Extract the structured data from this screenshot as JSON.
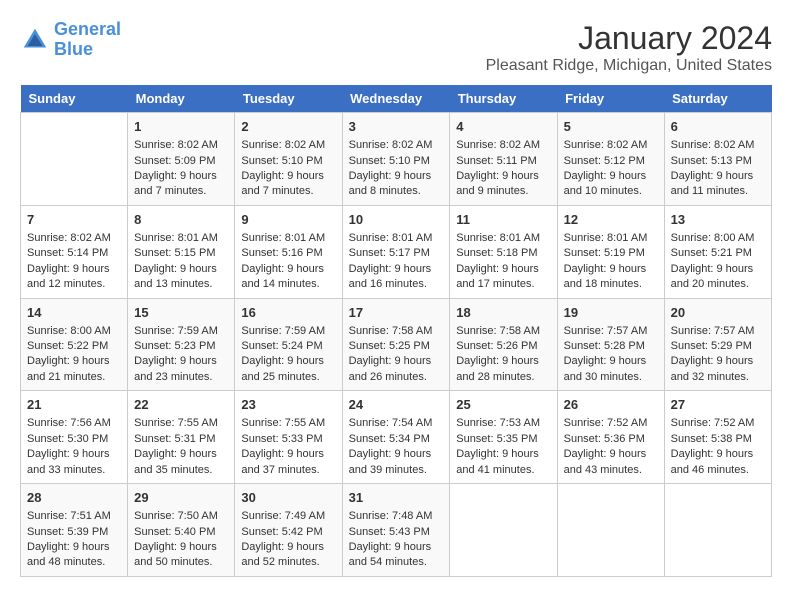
{
  "header": {
    "logo_line1": "General",
    "logo_line2": "Blue",
    "title": "January 2024",
    "subtitle": "Pleasant Ridge, Michigan, United States"
  },
  "days_of_week": [
    "Sunday",
    "Monday",
    "Tuesday",
    "Wednesday",
    "Thursday",
    "Friday",
    "Saturday"
  ],
  "weeks": [
    [
      {
        "num": "",
        "info": ""
      },
      {
        "num": "1",
        "info": "Sunrise: 8:02 AM\nSunset: 5:09 PM\nDaylight: 9 hours\nand 7 minutes."
      },
      {
        "num": "2",
        "info": "Sunrise: 8:02 AM\nSunset: 5:10 PM\nDaylight: 9 hours\nand 7 minutes."
      },
      {
        "num": "3",
        "info": "Sunrise: 8:02 AM\nSunset: 5:10 PM\nDaylight: 9 hours\nand 8 minutes."
      },
      {
        "num": "4",
        "info": "Sunrise: 8:02 AM\nSunset: 5:11 PM\nDaylight: 9 hours\nand 9 minutes."
      },
      {
        "num": "5",
        "info": "Sunrise: 8:02 AM\nSunset: 5:12 PM\nDaylight: 9 hours\nand 10 minutes."
      },
      {
        "num": "6",
        "info": "Sunrise: 8:02 AM\nSunset: 5:13 PM\nDaylight: 9 hours\nand 11 minutes."
      }
    ],
    [
      {
        "num": "7",
        "info": "Sunrise: 8:02 AM\nSunset: 5:14 PM\nDaylight: 9 hours\nand 12 minutes."
      },
      {
        "num": "8",
        "info": "Sunrise: 8:01 AM\nSunset: 5:15 PM\nDaylight: 9 hours\nand 13 minutes."
      },
      {
        "num": "9",
        "info": "Sunrise: 8:01 AM\nSunset: 5:16 PM\nDaylight: 9 hours\nand 14 minutes."
      },
      {
        "num": "10",
        "info": "Sunrise: 8:01 AM\nSunset: 5:17 PM\nDaylight: 9 hours\nand 16 minutes."
      },
      {
        "num": "11",
        "info": "Sunrise: 8:01 AM\nSunset: 5:18 PM\nDaylight: 9 hours\nand 17 minutes."
      },
      {
        "num": "12",
        "info": "Sunrise: 8:01 AM\nSunset: 5:19 PM\nDaylight: 9 hours\nand 18 minutes."
      },
      {
        "num": "13",
        "info": "Sunrise: 8:00 AM\nSunset: 5:21 PM\nDaylight: 9 hours\nand 20 minutes."
      }
    ],
    [
      {
        "num": "14",
        "info": "Sunrise: 8:00 AM\nSunset: 5:22 PM\nDaylight: 9 hours\nand 21 minutes."
      },
      {
        "num": "15",
        "info": "Sunrise: 7:59 AM\nSunset: 5:23 PM\nDaylight: 9 hours\nand 23 minutes."
      },
      {
        "num": "16",
        "info": "Sunrise: 7:59 AM\nSunset: 5:24 PM\nDaylight: 9 hours\nand 25 minutes."
      },
      {
        "num": "17",
        "info": "Sunrise: 7:58 AM\nSunset: 5:25 PM\nDaylight: 9 hours\nand 26 minutes."
      },
      {
        "num": "18",
        "info": "Sunrise: 7:58 AM\nSunset: 5:26 PM\nDaylight: 9 hours\nand 28 minutes."
      },
      {
        "num": "19",
        "info": "Sunrise: 7:57 AM\nSunset: 5:28 PM\nDaylight: 9 hours\nand 30 minutes."
      },
      {
        "num": "20",
        "info": "Sunrise: 7:57 AM\nSunset: 5:29 PM\nDaylight: 9 hours\nand 32 minutes."
      }
    ],
    [
      {
        "num": "21",
        "info": "Sunrise: 7:56 AM\nSunset: 5:30 PM\nDaylight: 9 hours\nand 33 minutes."
      },
      {
        "num": "22",
        "info": "Sunrise: 7:55 AM\nSunset: 5:31 PM\nDaylight: 9 hours\nand 35 minutes."
      },
      {
        "num": "23",
        "info": "Sunrise: 7:55 AM\nSunset: 5:33 PM\nDaylight: 9 hours\nand 37 minutes."
      },
      {
        "num": "24",
        "info": "Sunrise: 7:54 AM\nSunset: 5:34 PM\nDaylight: 9 hours\nand 39 minutes."
      },
      {
        "num": "25",
        "info": "Sunrise: 7:53 AM\nSunset: 5:35 PM\nDaylight: 9 hours\nand 41 minutes."
      },
      {
        "num": "26",
        "info": "Sunrise: 7:52 AM\nSunset: 5:36 PM\nDaylight: 9 hours\nand 43 minutes."
      },
      {
        "num": "27",
        "info": "Sunrise: 7:52 AM\nSunset: 5:38 PM\nDaylight: 9 hours\nand 46 minutes."
      }
    ],
    [
      {
        "num": "28",
        "info": "Sunrise: 7:51 AM\nSunset: 5:39 PM\nDaylight: 9 hours\nand 48 minutes."
      },
      {
        "num": "29",
        "info": "Sunrise: 7:50 AM\nSunset: 5:40 PM\nDaylight: 9 hours\nand 50 minutes."
      },
      {
        "num": "30",
        "info": "Sunrise: 7:49 AM\nSunset: 5:42 PM\nDaylight: 9 hours\nand 52 minutes."
      },
      {
        "num": "31",
        "info": "Sunrise: 7:48 AM\nSunset: 5:43 PM\nDaylight: 9 hours\nand 54 minutes."
      },
      {
        "num": "",
        "info": ""
      },
      {
        "num": "",
        "info": ""
      },
      {
        "num": "",
        "info": ""
      }
    ]
  ]
}
